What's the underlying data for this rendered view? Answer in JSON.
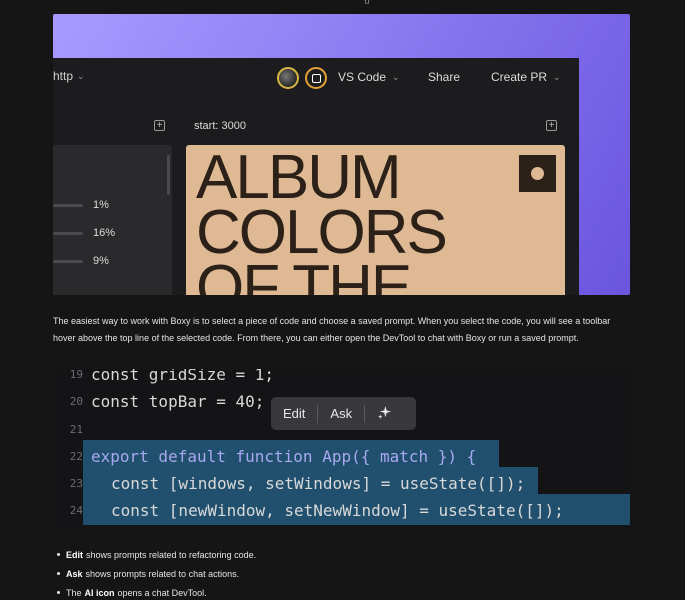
{
  "top_glyph": "{}",
  "hero": {
    "topbar": {
      "branch": "http",
      "editor": "VS Code",
      "share": "Share",
      "create_pr": "Create PR"
    },
    "left_panel": {
      "bars": [
        {
          "value": "1%",
          "fill": 0.01
        },
        {
          "value": "16%",
          "fill": 0.16
        },
        {
          "value": "9%",
          "fill": 0.09
        }
      ]
    },
    "right_panel": {
      "label": "start: 3000",
      "album_text": [
        "ALBUM",
        "COLORS",
        "OF THE"
      ]
    },
    "colors": {
      "gradient_start": "#a79bff",
      "gradient_end": "#6a55de",
      "album_bg": "#dfb994"
    }
  },
  "paragraph": "The easiest way to work with Boxy is to select a piece of code and choose a saved prompt. When you select the code, you will see a toolbar hover above the top line of the selected code. From there, you can either open the DevTool to chat with Boxy or run a saved prompt.",
  "code": {
    "lines": [
      {
        "n": "19",
        "text": "const gridSize = 1;"
      },
      {
        "n": "20",
        "text": "const topBar = 40;"
      },
      {
        "n": "21",
        "text": ""
      },
      {
        "n": "22",
        "text": "export default function App({ match }) {"
      },
      {
        "n": "23",
        "text": "const [windows, setWindows] = useState([]);"
      },
      {
        "n": "24",
        "text": "const [newWindow, setNewWindow] = useState([]);"
      }
    ],
    "toolbar": {
      "edit": "Edit",
      "ask": "Ask",
      "ai_icon": "sparkle-icon"
    }
  },
  "bullets": [
    {
      "bold": "Edit",
      "rest": "shows prompts related to refactoring code."
    },
    {
      "bold": "Ask",
      "rest": "shows prompts related to chat actions."
    },
    {
      "pre": "The",
      "bold": "AI icon",
      "rest": "opens a chat DevTool."
    }
  ]
}
